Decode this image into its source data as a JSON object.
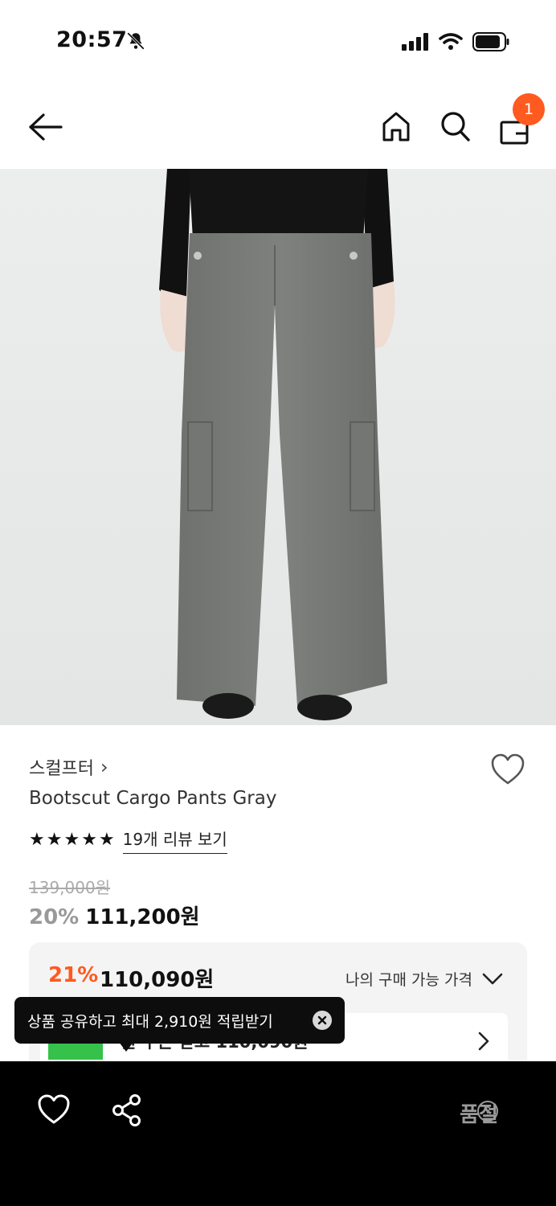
{
  "status_bar": {
    "time": "20:57"
  },
  "header": {
    "cart_count": "1"
  },
  "product": {
    "brand": "스컬프터",
    "brand_chevron": "›",
    "name": "Bootscut Cargo Pants Gray",
    "rating_stars": 5,
    "review_link": "19개 리뷰 보기",
    "original_price": "139,000원",
    "discount_percent": "20%",
    "sale_price": "111,200원"
  },
  "benefit": {
    "discount_percent": "21%",
    "price": "110,090원",
    "my_price_label": "나의 구매 가능 가격",
    "coupon_text": "원 쿠폰 받고 110,090원"
  },
  "tooltip": {
    "text": "상품 공유하고 최대 2,910원 적립받기"
  },
  "bottom_bar": {
    "soldout_label": "품절",
    "help_symbol": "?"
  },
  "colors": {
    "accent": "#ff5a1f",
    "bottom_bar": "#000000"
  },
  "icons": [
    "back-arrow-icon",
    "home-icon",
    "search-icon",
    "shopping-bag-icon",
    "heart-icon",
    "share-icon",
    "chevron-down-icon",
    "chevron-right-icon",
    "close-icon",
    "help-icon",
    "bell-slash-icon"
  ]
}
